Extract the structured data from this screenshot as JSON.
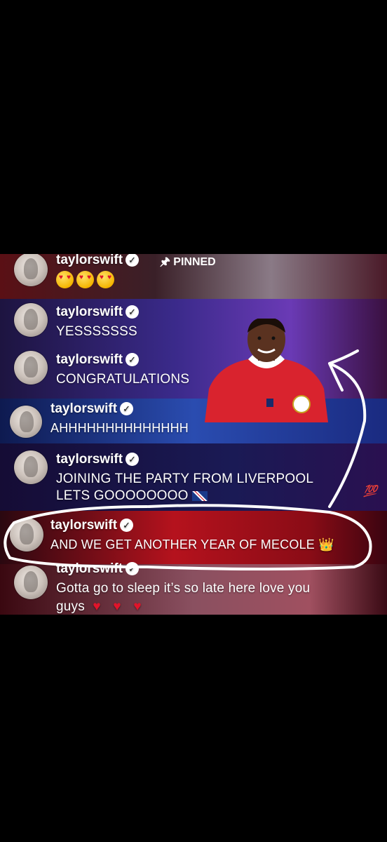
{
  "pinned": {
    "username": "taylorswift",
    "pin_label": "PINNED"
  },
  "comments": [
    {
      "username": "taylorswift",
      "text": "YESSSSSSS"
    },
    {
      "username": "taylorswift",
      "text": "CONGRATULATIONS"
    },
    {
      "username": "taylorswift",
      "text": "AHHHHHHHHHHHHHH"
    },
    {
      "username": "taylorswift",
      "text": "JOINING THE PARTY FROM LIVERPOOL",
      "text2": "LETS GOOOOOOOO"
    },
    {
      "username": "taylorswift",
      "text": "AND WE GET ANOTHER YEAR OF MECOLE"
    },
    {
      "username": "taylorswift",
      "text": "Gotta go to sleep it’s so late here love you",
      "text2": "guys"
    }
  ],
  "icons": {
    "verified": "verified-check-icon",
    "pin": "pin-icon",
    "crown": "crown-emoji",
    "heart": "red-heart-emoji",
    "hundred": "hundred-emoji"
  },
  "colors": {
    "highlight_row": "#b5121d",
    "annotation": "#ffffff"
  }
}
